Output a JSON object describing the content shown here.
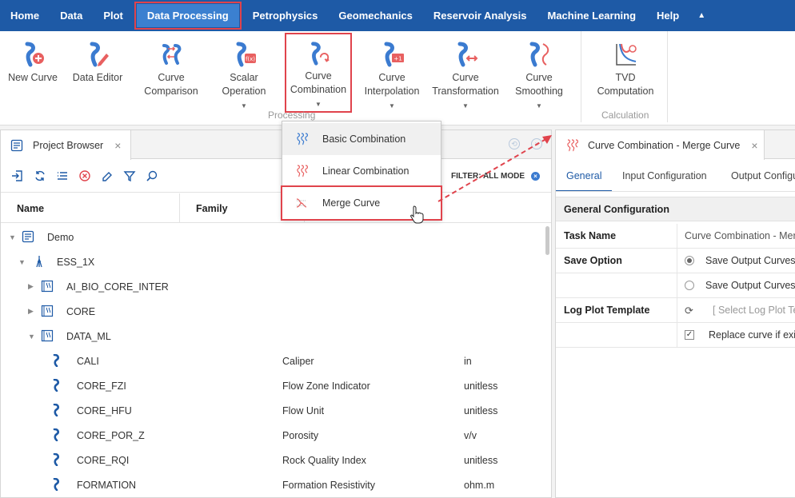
{
  "menu": {
    "items": [
      "Home",
      "Data",
      "Plot",
      "Data Processing",
      "Petrophysics",
      "Geomechanics",
      "Reservoir Analysis",
      "Machine Learning",
      "Help"
    ],
    "active": "Data Processing"
  },
  "ribbon": {
    "buttons": {
      "new_curve": "New Curve",
      "data_editor": "Data Editor",
      "curve_comparison": "Curve\nComparison",
      "scalar_operation": "Scalar\nOperation",
      "curve_combination": "Curve\nCombination",
      "curve_interpolation": "Curve\nInterpolation",
      "curve_transformation": "Curve\nTransformation",
      "curve_smoothing": "Curve\nSmoothing",
      "tvd_computation": "TVD\nComputation"
    },
    "groups": {
      "processing": "Processing",
      "calculation": "Calculation"
    }
  },
  "dropdown": {
    "items": [
      "Basic Combination",
      "Linear Combination",
      "Merge Curve"
    ]
  },
  "project_browser": {
    "tab_title": "Project Browser",
    "filter_label": "FILTER: ALL MODE",
    "columns": [
      "Name",
      "Family"
    ],
    "tree": [
      {
        "label": "Demo",
        "level": 0,
        "type": "project",
        "expanded": true
      },
      {
        "label": "ESS_1X",
        "level": 1,
        "type": "well",
        "expanded": true
      },
      {
        "label": "AI_BIO_CORE_INTER",
        "level": 2,
        "type": "dataset",
        "expanded": false
      },
      {
        "label": "CORE",
        "level": 2,
        "type": "dataset",
        "expanded": false
      },
      {
        "label": "DATA_ML",
        "level": 2,
        "type": "dataset",
        "expanded": true
      },
      {
        "label": "CALI",
        "level": 3,
        "type": "curve",
        "description": "Caliper",
        "unit": "in"
      },
      {
        "label": "CORE_FZI",
        "level": 3,
        "type": "curve",
        "description": "Flow Zone Indicator",
        "unit": "unitless"
      },
      {
        "label": "CORE_HFU",
        "level": 3,
        "type": "curve",
        "description": "Flow Unit",
        "unit": "unitless"
      },
      {
        "label": "CORE_POR_Z",
        "level": 3,
        "type": "curve",
        "description": "Porosity",
        "unit": "v/v"
      },
      {
        "label": "CORE_RQI",
        "level": 3,
        "type": "curve",
        "description": "Rock Quality Index",
        "unit": "unitless"
      },
      {
        "label": "FORMATION",
        "level": 3,
        "type": "curve",
        "description": "Formation Resistivity",
        "unit": "ohm.m"
      }
    ]
  },
  "merge_panel": {
    "tab_title": "Curve Combination - Merge Curve",
    "subtabs": [
      "General",
      "Input Configuration",
      "Output Configu"
    ],
    "section": "General Configuration",
    "task_name_label": "Task Name",
    "task_name_value": "Curve Combination - Merg",
    "save_option_label": "Save Option",
    "save_option_1": "Save Output Curves a",
    "save_option_2": "Save Output Curves O",
    "log_plot_label": "Log Plot Template",
    "log_plot_placeholder": "[ Select Log Plot Ter",
    "replace_label": "Replace curve if exist"
  }
}
